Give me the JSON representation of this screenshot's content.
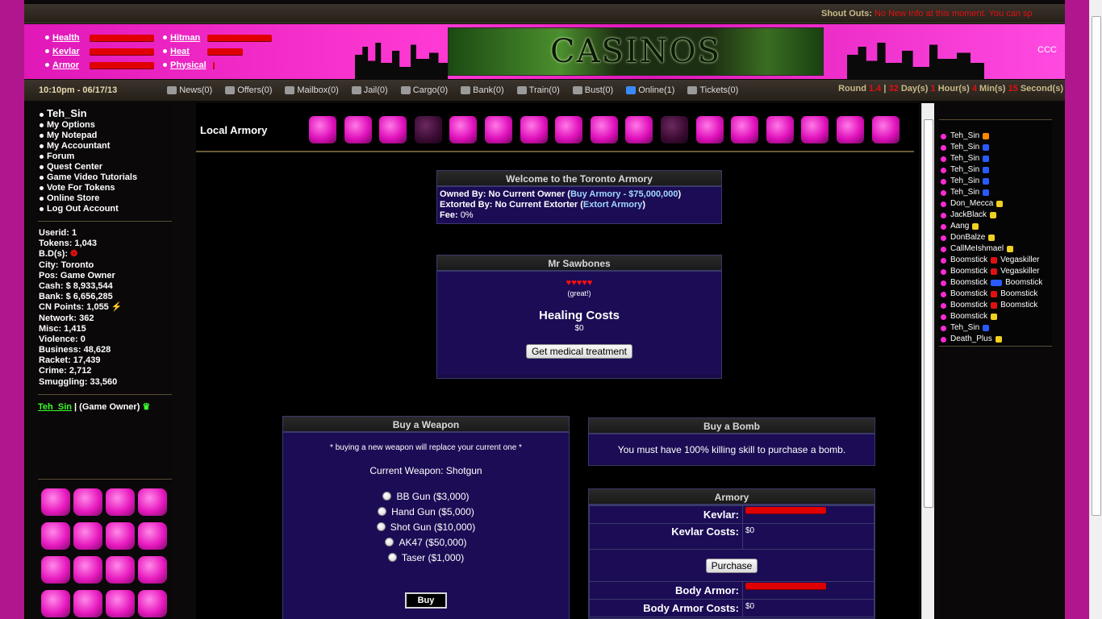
{
  "shout": {
    "label": "Shout Outs:",
    "message": "No New Info at this moment. You can sp"
  },
  "stats_top": [
    {
      "label": "Health",
      "level": 1.0
    },
    {
      "label": "Kevlar",
      "level": 1.0
    },
    {
      "label": "Armor",
      "level": 1.0
    }
  ],
  "stats_top2": [
    {
      "label": "Hitman",
      "level": 1.0
    },
    {
      "label": "Heat",
      "level": 0.55
    },
    {
      "label": "Physical",
      "level": 0.0
    }
  ],
  "logo_text": "CASINOS",
  "ccc": "CCC",
  "nav": {
    "time": "10:10pm - 06/17/13",
    "items": [
      "News(0)",
      "Offers(0)",
      "Mailbox(0)",
      "Jail(0)",
      "Cargo(0)",
      "Bank(0)",
      "Train(0)",
      "Bust(0)",
      "Online(1)",
      "Tickets(0)"
    ],
    "round_label": "Round",
    "round_num": "1.4",
    "days": "32",
    "days_label": "Day(s)",
    "hours": "1",
    "hours_label": "Hour(s)",
    "mins": "4",
    "mins_label": "Min(s)",
    "secs": "15",
    "secs_label": "Second(s)"
  },
  "left_menu": {
    "username": "Teh_Sin",
    "items": [
      "My Options",
      "My Notepad",
      "My Accountant",
      "Forum",
      "Quest Center",
      "Game Video Tutorials",
      "Vote For Tokens",
      "Online Store",
      "Log Out Account"
    ]
  },
  "left_stats": [
    "Userid: 1",
    "Tokens: 1,043",
    "B.D(s):",
    "City: Toronto",
    "Pos: Game Owner",
    "Cash: $ 8,933,544",
    "Bank: $ 6,656,285",
    "CN Points: 1,055",
    "Network: 362",
    "Misc: 1,415",
    "Violence: 0",
    "Business: 48,628",
    "Racket: 17,439",
    "Crime: 2,712",
    "Smuggling: 33,560"
  ],
  "owner_line": {
    "name": "Teh_Sin",
    "role": " | (Game Owner)"
  },
  "main": {
    "title": "Local Armory",
    "welcome": {
      "heading": "Welcome to the Toronto Armory",
      "owned_label": "Owned By: No Current Owner (",
      "owned_link": "Buy Armory - $75,000,000",
      "owned_end": ")",
      "extorted_label": "Extorted By: No Current Extorter (",
      "extorted_link": "Extort Armory",
      "extorted_end": ")",
      "fee_label": "Fee:",
      "fee_value": "0%"
    },
    "sawbones": {
      "heading": "Mr Sawbones",
      "hearts": "♥♥♥♥♥",
      "rating": "(great!)",
      "healing_title": "Healing Costs",
      "healing_cost": "$0",
      "button": "Get medical treatment"
    },
    "weapon": {
      "heading": "Buy a Weapon",
      "note": "* buying a new weapon will replace your current one *",
      "current": "Current Weapon: Shotgun",
      "options": [
        "BB Gun ($3,000)",
        "Hand Gun ($5,000)",
        "Shot Gun ($10,000)",
        "AK47 ($50,000)",
        "Taser ($1,000)"
      ],
      "button": "Buy"
    },
    "bomb": {
      "heading": "Buy a Bomb",
      "message": "You must have 100% killing skill to purchase a bomb."
    },
    "armory": {
      "heading": "Armory",
      "kevlar_label": "Kevlar:",
      "kevlar_level": 1.0,
      "kevlar_costs_label": "Kevlar Costs:",
      "kevlar_costs": "$0",
      "purchase": "Purchase",
      "body_label": "Body Armor:",
      "body_level": 1.0,
      "body_costs_label": "Body Armor Costs:",
      "body_costs": "$0"
    }
  },
  "online": [
    {
      "name": "Teh_Sin",
      "extra": ""
    },
    {
      "name": "Teh_Sin",
      "extra": ""
    },
    {
      "name": "Teh_Sin",
      "extra": ""
    },
    {
      "name": "Teh_Sin",
      "extra": ""
    },
    {
      "name": "Teh_Sin",
      "extra": ""
    },
    {
      "name": "Teh_Sin",
      "extra": ""
    },
    {
      "name": "Don_Mecca",
      "extra": ""
    },
    {
      "name": "JackBlack",
      "extra": ""
    },
    {
      "name": "Aang",
      "extra": ""
    },
    {
      "name": "DonBalze",
      "extra": ""
    },
    {
      "name": "CallMeIshmael",
      "extra": ""
    },
    {
      "name": "Boomstick",
      "extra": "Vegaskiller"
    },
    {
      "name": "Boomstick",
      "extra": "Vegaskiller"
    },
    {
      "name": "Boomstick",
      "extra": "Boomstick"
    },
    {
      "name": "Boomstick",
      "extra": "Boomstick"
    },
    {
      "name": "Boomstick",
      "extra": "Boomstick"
    },
    {
      "name": "Boomstick",
      "extra": ""
    },
    {
      "name": "Teh_Sin",
      "extra": ""
    },
    {
      "name": "Death_Plus",
      "extra": ""
    }
  ],
  "colors": {
    "accent": "#e018b8",
    "bar_red": "#e00000",
    "panel": "#1c0c55",
    "link": "#9fd8ff"
  }
}
